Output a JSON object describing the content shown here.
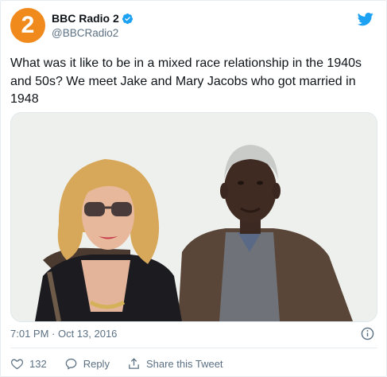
{
  "tweet": {
    "author": {
      "display_name": "BBC Radio 2",
      "handle": "@BBCRadio2",
      "avatar_text": "2",
      "verified": true,
      "brand_color": "#f08a1d"
    },
    "text": "What was it like to be in a mixed race relationship in the 1940s and 50s? We meet Jake and Mary Jacobs who got married in 1948",
    "image_description_icon": "photo",
    "timestamp": "7:01 PM · Oct 13, 2016",
    "actions": {
      "like_count": "132",
      "reply_label": "Reply",
      "share_label": "Share this Tweet"
    }
  },
  "colors": {
    "twitter_blue": "#1da1f2",
    "verified_blue": "#1da1f2",
    "secondary_text": "#5b7083"
  },
  "icons": {
    "verified": "verified-badge-icon",
    "bird": "twitter-bird-icon",
    "info": "info-icon",
    "like": "heart-icon",
    "reply": "reply-icon",
    "share": "share-icon"
  }
}
